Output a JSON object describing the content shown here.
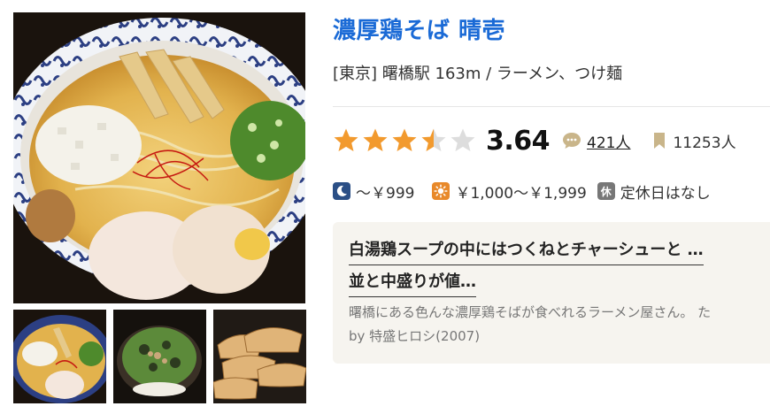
{
  "restaurant": {
    "name": "濃厚鶏そば 晴壱",
    "area_line": "[東京] 曙橋駅 163m / ラーメン、つけ麺"
  },
  "rating": {
    "score": "3.64",
    "stars": 3.5,
    "review_count": "421人",
    "bookmark_count": "11253人",
    "star_color": "#f29a2e",
    "star_empty_color": "#dddddd"
  },
  "budget": {
    "dinner": "～￥999",
    "lunch": "￥1,000～￥1,999",
    "holiday_label": "休",
    "holiday": "定休日はなし"
  },
  "review": {
    "title_line1": "白湯鶏スープの中にはつくねとチャーシューと …",
    "title_line2": "並と中盛りが値…",
    "body": "曙橋にある色んな濃厚鶏そばが食べれるラーメン屋さん。 た",
    "author": "by 特盛ヒロシ(2007)"
  },
  "photos": {
    "main": "ramen-photo",
    "thumbs": [
      "ramen-thumb",
      "rice-bowl-thumb",
      "gyoza-thumb"
    ]
  },
  "colors": {
    "title": "#1a6ad6",
    "card_bg": "#f6f4ef"
  }
}
